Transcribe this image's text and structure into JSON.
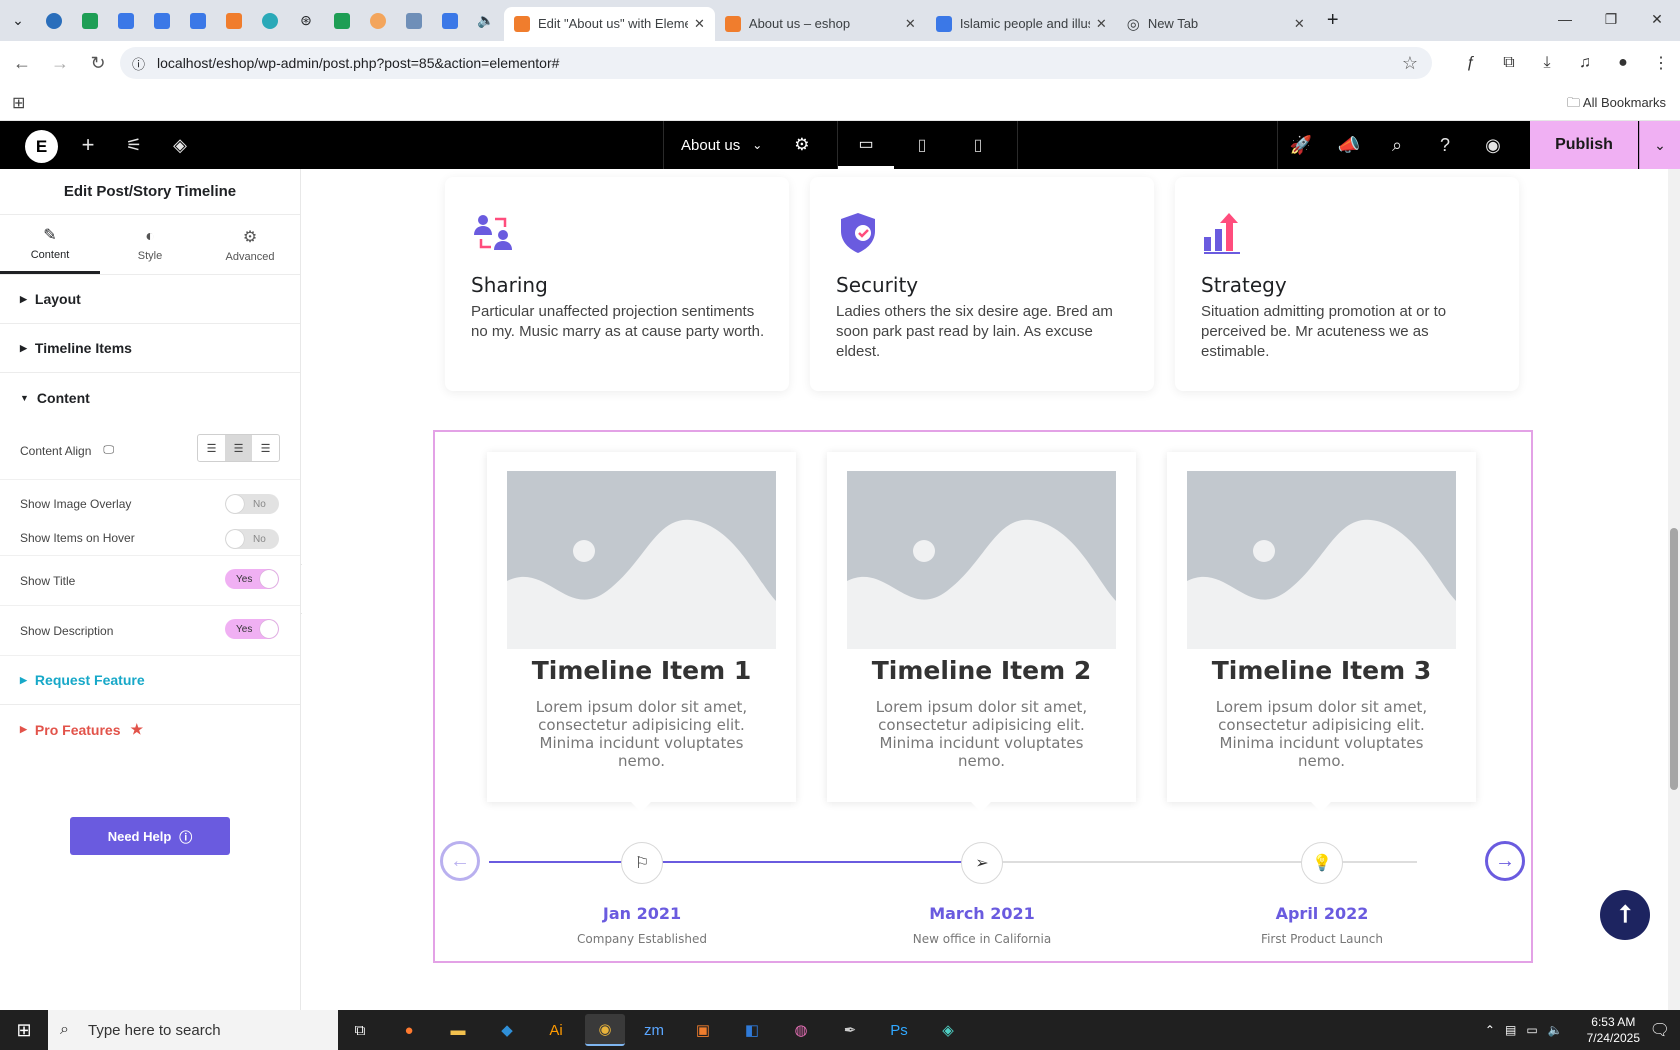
{
  "browser": {
    "tabs": [
      {
        "title": "Edit \"About us\" with Elementor",
        "active": true
      },
      {
        "title": "About us – eshop",
        "active": false
      },
      {
        "title": "Islamic people and illustr",
        "active": false
      },
      {
        "title": "New Tab",
        "active": false
      }
    ],
    "url": "localhost/eshop/wp-admin/post.php?post=85&action=elementor#",
    "all_bookmarks": "All Bookmarks"
  },
  "editor_bar": {
    "page_name": "About us",
    "publish": "Publish"
  },
  "panel": {
    "title": "Edit Post/Story Timeline",
    "tabs": [
      "Content",
      "Style",
      "Advanced"
    ],
    "sections": {
      "layout": "Layout",
      "timeline_items": "Timeline Items",
      "content": "Content"
    },
    "content_align": "Content Align",
    "show_image_overlay": {
      "label": "Show Image Overlay",
      "value": "No"
    },
    "show_items_on_hover": {
      "label": "Show Items on Hover",
      "value": "No"
    },
    "show_title": {
      "label": "Show Title",
      "value": "Yes"
    },
    "show_description": {
      "label": "Show Description",
      "value": "Yes"
    },
    "request_feature": "Request Feature",
    "pro_features": "Pro Features",
    "need_help": "Need Help"
  },
  "features": [
    {
      "title": "Sharing",
      "text": "Particular unaffected projection sentiments no my. Music marry as at cause party worth."
    },
    {
      "title": "Security",
      "text": "Ladies others the six desire age. Bred am soon park past read by lain. As excuse eldest."
    },
    {
      "title": "Strategy",
      "text": "Situation admitting promotion at or to perceived be. Mr acuteness we as estimable."
    }
  ],
  "timeline": [
    {
      "title": "Timeline Item 1",
      "text": "Lorem ipsum dolor sit amet, consectetur adipisicing elit. Minima incidunt voluptates nemo.",
      "date": "Jan 2021",
      "caption": "Company Established",
      "icon": "flag-icon"
    },
    {
      "title": "Timeline Item 2",
      "text": "Lorem ipsum dolor sit amet, consectetur adipisicing elit. Minima incidunt voluptates nemo.",
      "date": "March 2021",
      "caption": "New office in California",
      "icon": "paper-plane-icon"
    },
    {
      "title": "Timeline Item 3",
      "text": "Lorem ipsum dolor sit amet, consectetur adipisicing elit. Minima incidunt voluptates nemo.",
      "date": "April 2022",
      "caption": "First Product Launch",
      "icon": "lightbulb-icon"
    }
  ],
  "taskbar": {
    "search_placeholder": "Type here to search",
    "time": "6:53 AM",
    "date": "7/24/2025"
  },
  "colors": {
    "accent": "#6a5bdf",
    "publish_bg": "#f0b0f3",
    "pro_red": "#e2534a",
    "request_blue": "#17a8c8"
  }
}
